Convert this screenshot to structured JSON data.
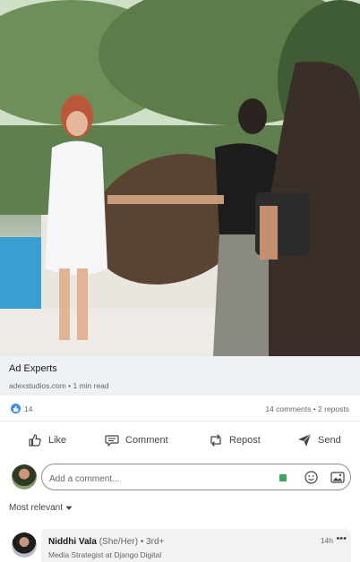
{
  "post": {
    "image": {
      "alt_icon": "photo-scene"
    },
    "link_card": {
      "title": "Ad Experts",
      "meta": "adexstudios.com • 1 min read"
    },
    "social": {
      "reactions": "14",
      "comments_reposts": "14 comments • 2 reposts"
    },
    "actions": [
      {
        "label": "Like",
        "icon": "thumbs-up-icon"
      },
      {
        "label": "Comment",
        "icon": "comment-bubble-icon"
      },
      {
        "label": "Repost",
        "icon": "repost-icon"
      },
      {
        "label": "Send",
        "icon": "send-icon"
      }
    ]
  },
  "comment_box": {
    "placeholder": "Add a comment..."
  },
  "sort": {
    "label": "Most relevant"
  },
  "first_comment": {
    "name": "Niddhi Vala",
    "pronouns": "(She/Her)",
    "degree": "• 3rd+",
    "headline": "Media Strategist at Django Digital",
    "time": "14h",
    "more": "•••"
  },
  "colors": {
    "accent": "#378fe9",
    "green": "#3da55d"
  }
}
